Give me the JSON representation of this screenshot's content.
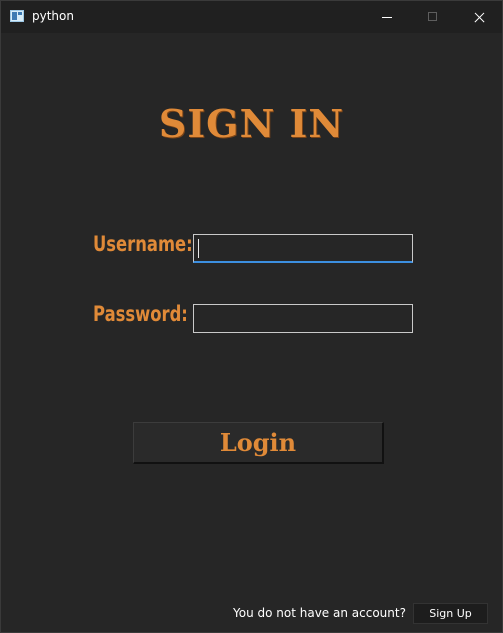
{
  "window": {
    "title": "python",
    "icons": [
      "app-icon",
      "minimize-icon",
      "maximize-icon",
      "close-icon"
    ]
  },
  "form": {
    "heading": "SIGN IN",
    "username_label": "Username:",
    "username_value": "",
    "password_label": "Password:",
    "password_value": "",
    "login_label": "Login"
  },
  "footer": {
    "prompt": "You do not have an account?",
    "signup_label": "Sign Up"
  },
  "colors": {
    "accent": "#e08a38",
    "background": "#262626",
    "focus": "#3c8fe0"
  }
}
